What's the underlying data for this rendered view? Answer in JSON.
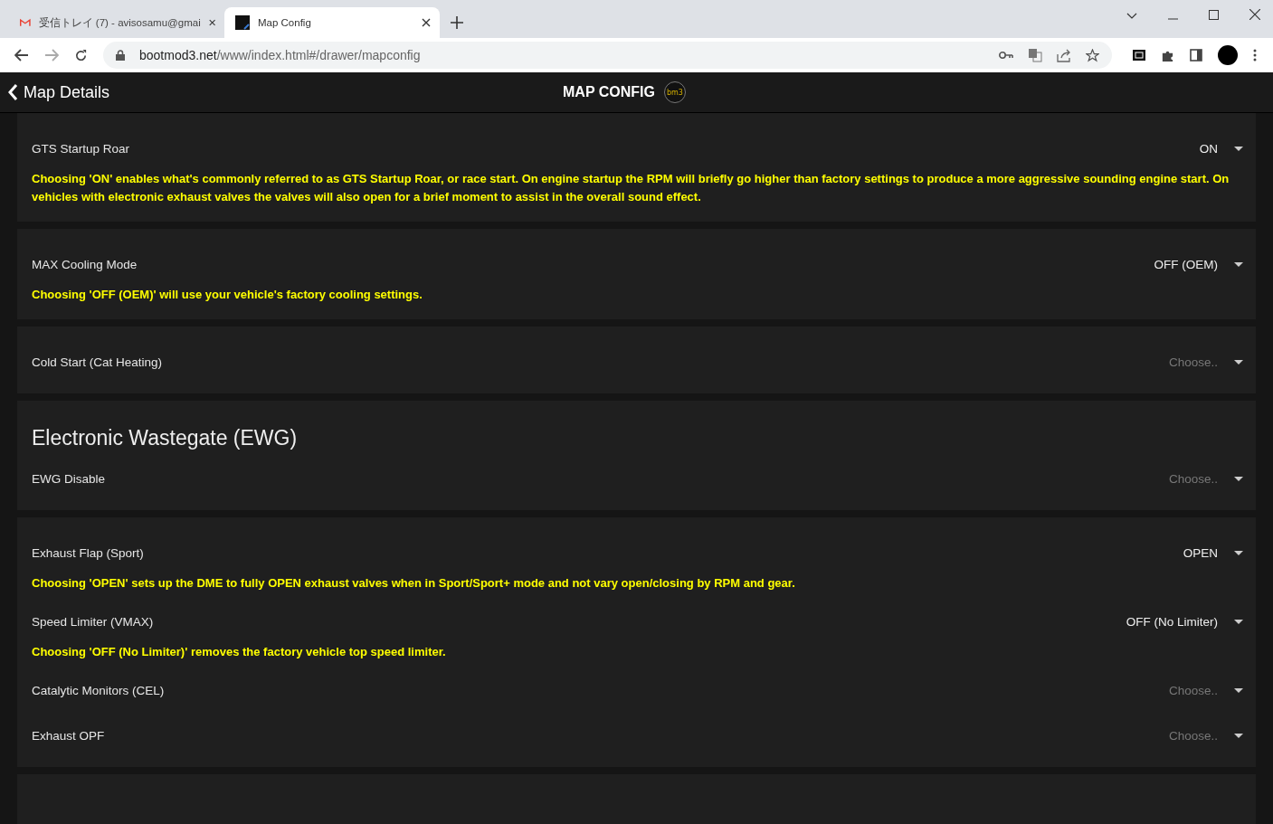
{
  "browser": {
    "tabs": [
      {
        "title": "受信トレイ (7) - avisosamu@gmai",
        "selected": false
      },
      {
        "title": "Map Config",
        "selected": true
      }
    ],
    "url": {
      "host": "bootmod3.net",
      "path": "/www/index.html#/drawer/mapconfig"
    }
  },
  "header": {
    "back_label": "Map Details",
    "title": "MAP CONFIG",
    "logo_text": "bm3"
  },
  "cards": [
    {
      "settings": [
        {
          "label": "GTS Startup Roar",
          "value": "ON",
          "description": "Choosing 'ON' enables what's commonly referred to as GTS Startup Roar, or race start. On engine startup the RPM will briefly go higher than factory settings to produce a more aggressive sounding engine start. On vehicles with electronic exhaust valves the valves will also open for a brief moment to assist in the overall sound effect."
        }
      ]
    },
    {
      "settings": [
        {
          "label": "MAX Cooling Mode",
          "value": "OFF (OEM)",
          "description": "Choosing 'OFF (OEM)' will use your vehicle's factory cooling settings."
        }
      ]
    },
    {
      "settings": [
        {
          "label": "Cold Start (Cat Heating)",
          "placeholder": "Choose.."
        }
      ]
    },
    {
      "heading": "Electronic Wastegate (EWG)",
      "settings": [
        {
          "label": "EWG Disable",
          "placeholder": "Choose.."
        }
      ]
    },
    {
      "settings": [
        {
          "label": "Exhaust Flap (Sport)",
          "value": "OPEN",
          "description": "Choosing 'OPEN' sets up the DME to fully OPEN exhaust valves when in Sport/Sport+ mode and not vary open/closing by RPM and gear."
        },
        {
          "label": "Speed Limiter (VMAX)",
          "value": "OFF (No Limiter)",
          "description": "Choosing 'OFF (No Limiter)' removes the factory vehicle top speed limiter."
        },
        {
          "label": "Catalytic Monitors (CEL)",
          "placeholder": "Choose.."
        },
        {
          "label": "Exhaust OPF",
          "placeholder": "Choose.."
        }
      ]
    }
  ]
}
